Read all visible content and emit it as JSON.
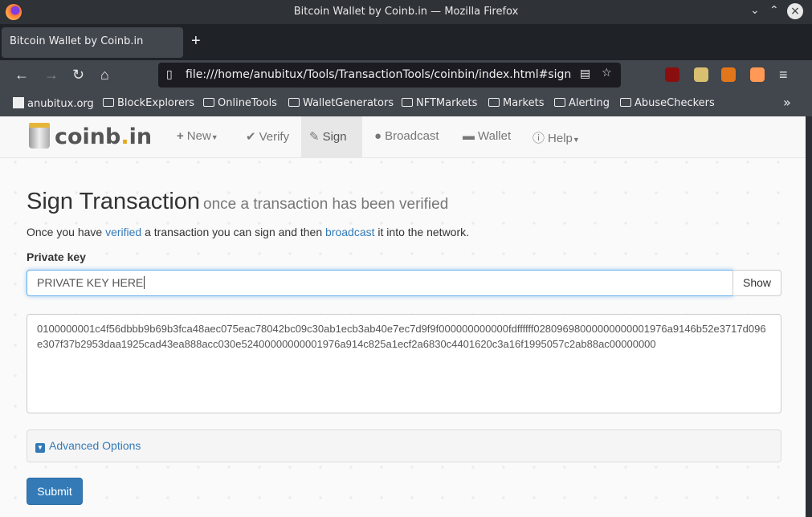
{
  "window": {
    "title": "Bitcoin Wallet by Coinb.in — Mozilla Firefox"
  },
  "tab": {
    "label": "Bitcoin Wallet by Coinb.in"
  },
  "address_bar": {
    "url": "file:///home/anubitux/Tools/TransactionTools/coinbin/index.html#sign"
  },
  "bookmarks": [
    "anubitux.org",
    "BlockExplorers",
    "OnlineTools",
    "WalletGenerators",
    "NFTMarkets",
    "Markets",
    "Alerting",
    "AbuseCheckers"
  ],
  "site": {
    "logo_main": "coinb",
    "logo_dot": ".",
    "logo_tld": "in",
    "nav": [
      {
        "label": "New",
        "icon": "plus-icon"
      },
      {
        "label": "Verify",
        "icon": "check-icon"
      },
      {
        "label": "Sign",
        "icon": "pencil-icon"
      },
      {
        "label": "Broadcast",
        "icon": "globe-icon"
      },
      {
        "label": "Wallet",
        "icon": "briefcase-icon"
      },
      {
        "label": "Help",
        "icon": "info-icon"
      }
    ]
  },
  "main": {
    "title": "Sign Transaction",
    "subtitle": "once a transaction has been verified",
    "lead_1": "Once you have ",
    "lead_link_1": "verified",
    "lead_2": " a transaction you can sign and then ",
    "lead_link_2": "broadcast",
    "lead_3": " it into the network.",
    "private_key_label": "Private key",
    "private_key_value": "PRIVATE KEY HERE",
    "show_label": "Show",
    "transaction": "0100000001c4f56dbbb9b69b3fca48aec075eac78042bc09c30ab1ecb3ab40e7ec7d9f9f000000000000fdffffff02809698000000000001976a9146b52e3717d096e307f37b2953daa1925cad43ea888acc030e52400000000001976a914c825a1ecf2a6830c4401620c3a16f1995057c2ab88ac00000000",
    "advanced_label": "Advanced Options",
    "submit_label": "Submit"
  }
}
